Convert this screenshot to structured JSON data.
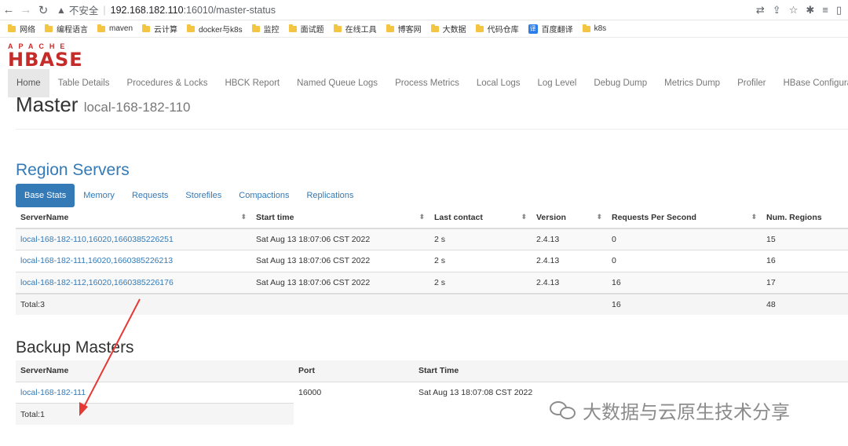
{
  "browser": {
    "insecure_label": "不安全",
    "url_host": "192.168.182.110",
    "url_path": ":16010/master-status",
    "bookmarks": [
      "网络",
      "编程语言",
      "maven",
      "云计算",
      "docker与k8s",
      "监控",
      "面试题",
      "在线工具",
      "博客网",
      "大数据",
      "代码仓库",
      "百度翻译",
      "k8s"
    ]
  },
  "logo": {
    "apache": "APACHE",
    "hbase": "HBASE"
  },
  "nav": [
    "Home",
    "Table Details",
    "Procedures & Locks",
    "HBCK Report",
    "Named Queue Logs",
    "Process Metrics",
    "Local Logs",
    "Log Level",
    "Debug Dump",
    "Metrics Dump",
    "Profiler",
    "HBase Configuration"
  ],
  "master": {
    "title": "Master",
    "host": "local-168-182-110"
  },
  "region_servers": {
    "title": "Region Servers",
    "tabs": [
      "Base Stats",
      "Memory",
      "Requests",
      "Storefiles",
      "Compactions",
      "Replications"
    ],
    "columns": [
      "ServerName",
      "Start time",
      "Last contact",
      "Version",
      "Requests Per Second",
      "Num. Regions"
    ],
    "rows": [
      [
        "local-168-182-110,16020,1660385226251",
        "Sat Aug 13 18:07:06 CST 2022",
        "2 s",
        "2.4.13",
        "0",
        "15"
      ],
      [
        "local-168-182-111,16020,1660385226213",
        "Sat Aug 13 18:07:06 CST 2022",
        "2 s",
        "2.4.13",
        "0",
        "16"
      ],
      [
        "local-168-182-112,16020,1660385226176",
        "Sat Aug 13 18:07:06 CST 2022",
        "2 s",
        "2.4.13",
        "16",
        "17"
      ]
    ],
    "total": {
      "label": "Total:3",
      "requests": "16",
      "regions": "48"
    }
  },
  "backup_masters": {
    "title": "Backup Masters",
    "columns": [
      "ServerName",
      "Port",
      "Start Time"
    ],
    "rows": [
      [
        "local-168-182-111",
        "16000",
        "Sat Aug 13 18:07:08 CST 2022"
      ]
    ],
    "total": "Total:1"
  },
  "watermark": "大数据与云原生技术分享",
  "colors": {
    "link": "#337ab7",
    "logo": "#c52b28",
    "arrow": "#e53935"
  }
}
